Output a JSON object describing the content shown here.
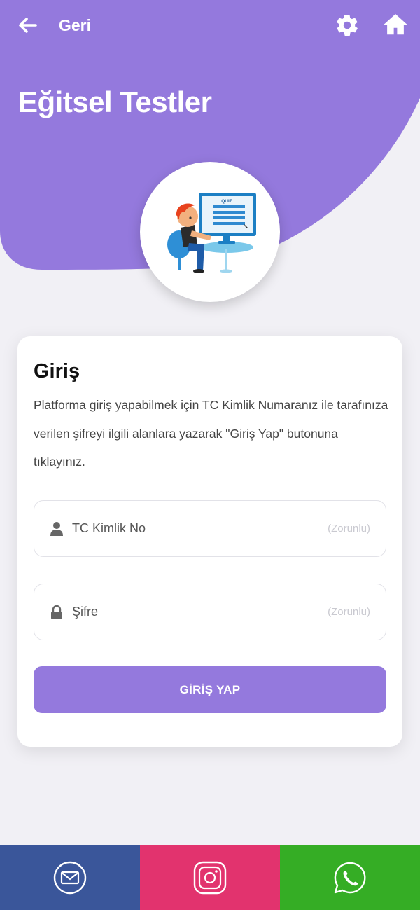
{
  "colors": {
    "primary": "#9479dd",
    "background": "#f1f0f5",
    "mail": "#3a569a",
    "instagram": "#e2336e",
    "whatsapp": "#35ad25"
  },
  "topbar": {
    "back_label": "Geri",
    "back_icon": "arrow-left-icon",
    "settings_icon": "gear-icon",
    "home_icon": "home-icon"
  },
  "header": {
    "title": "Eğitsel Testler",
    "hero_image": "quiz-student-illustration",
    "quiz_screen_text": "QUIZ"
  },
  "login_card": {
    "title": "Giriş",
    "description": "Platforma giriş yapabilmek için TC Kimlik Numaranız ile tarafınıza verilen şifreyi ilgili alanlara yazarak \"Giriş Yap\" butonuna tıklayınız.",
    "fields": [
      {
        "placeholder": "TC Kimlik No",
        "value": "",
        "required_label": "(Zorunlu)",
        "icon": "user-icon"
      },
      {
        "placeholder": "Şifre",
        "value": "",
        "required_label": "(Zorunlu)",
        "icon": "lock-icon"
      }
    ],
    "submit_label": "GİRİŞ YAP"
  },
  "footer": {
    "buttons": [
      {
        "icon": "mail-icon"
      },
      {
        "icon": "instagram-icon"
      },
      {
        "icon": "whatsapp-icon"
      }
    ]
  }
}
